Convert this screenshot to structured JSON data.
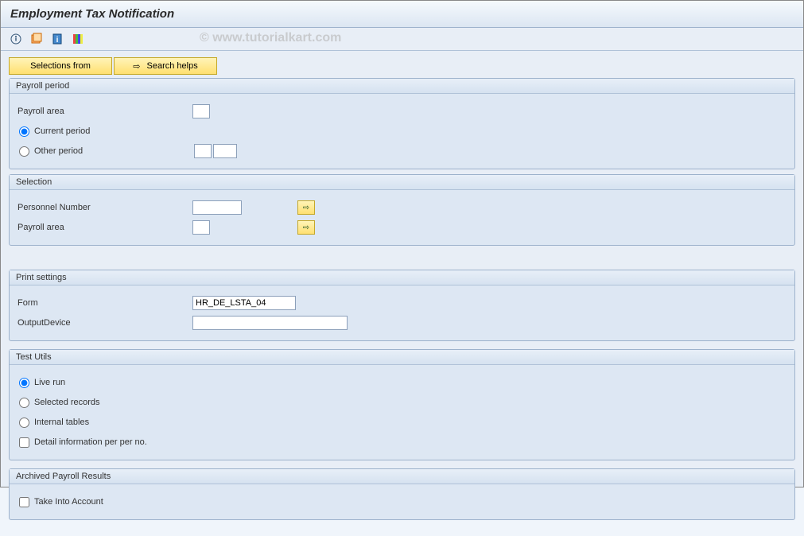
{
  "window": {
    "title": "Employment Tax Notification"
  },
  "watermark": "© www.tutorialkart.com",
  "buttons": {
    "selections_from": "Selections from",
    "search_helps": "Search helps"
  },
  "groups": {
    "payroll_period": {
      "title": "Payroll period",
      "payroll_area_label": "Payroll area",
      "payroll_area_value": "",
      "current_period": "Current period",
      "other_period": "Other period"
    },
    "selection": {
      "title": "Selection",
      "personnel_number_label": "Personnel Number",
      "personnel_number_value": "",
      "payroll_area_label": "Payroll area",
      "payroll_area_value": ""
    },
    "print_settings": {
      "title": "Print settings",
      "form_label": "Form",
      "form_value": "HR_DE_LSTA_04",
      "output_device_label": "OutputDevice",
      "output_device_value": ""
    },
    "test_utils": {
      "title": "Test Utils",
      "live_run": "Live run",
      "selected_records": "Selected records",
      "internal_tables": "Internal tables",
      "detail_info": "Detail information per per no."
    },
    "archived": {
      "title": "Archived Payroll Results",
      "take_into_account": "Take Into Account"
    }
  }
}
